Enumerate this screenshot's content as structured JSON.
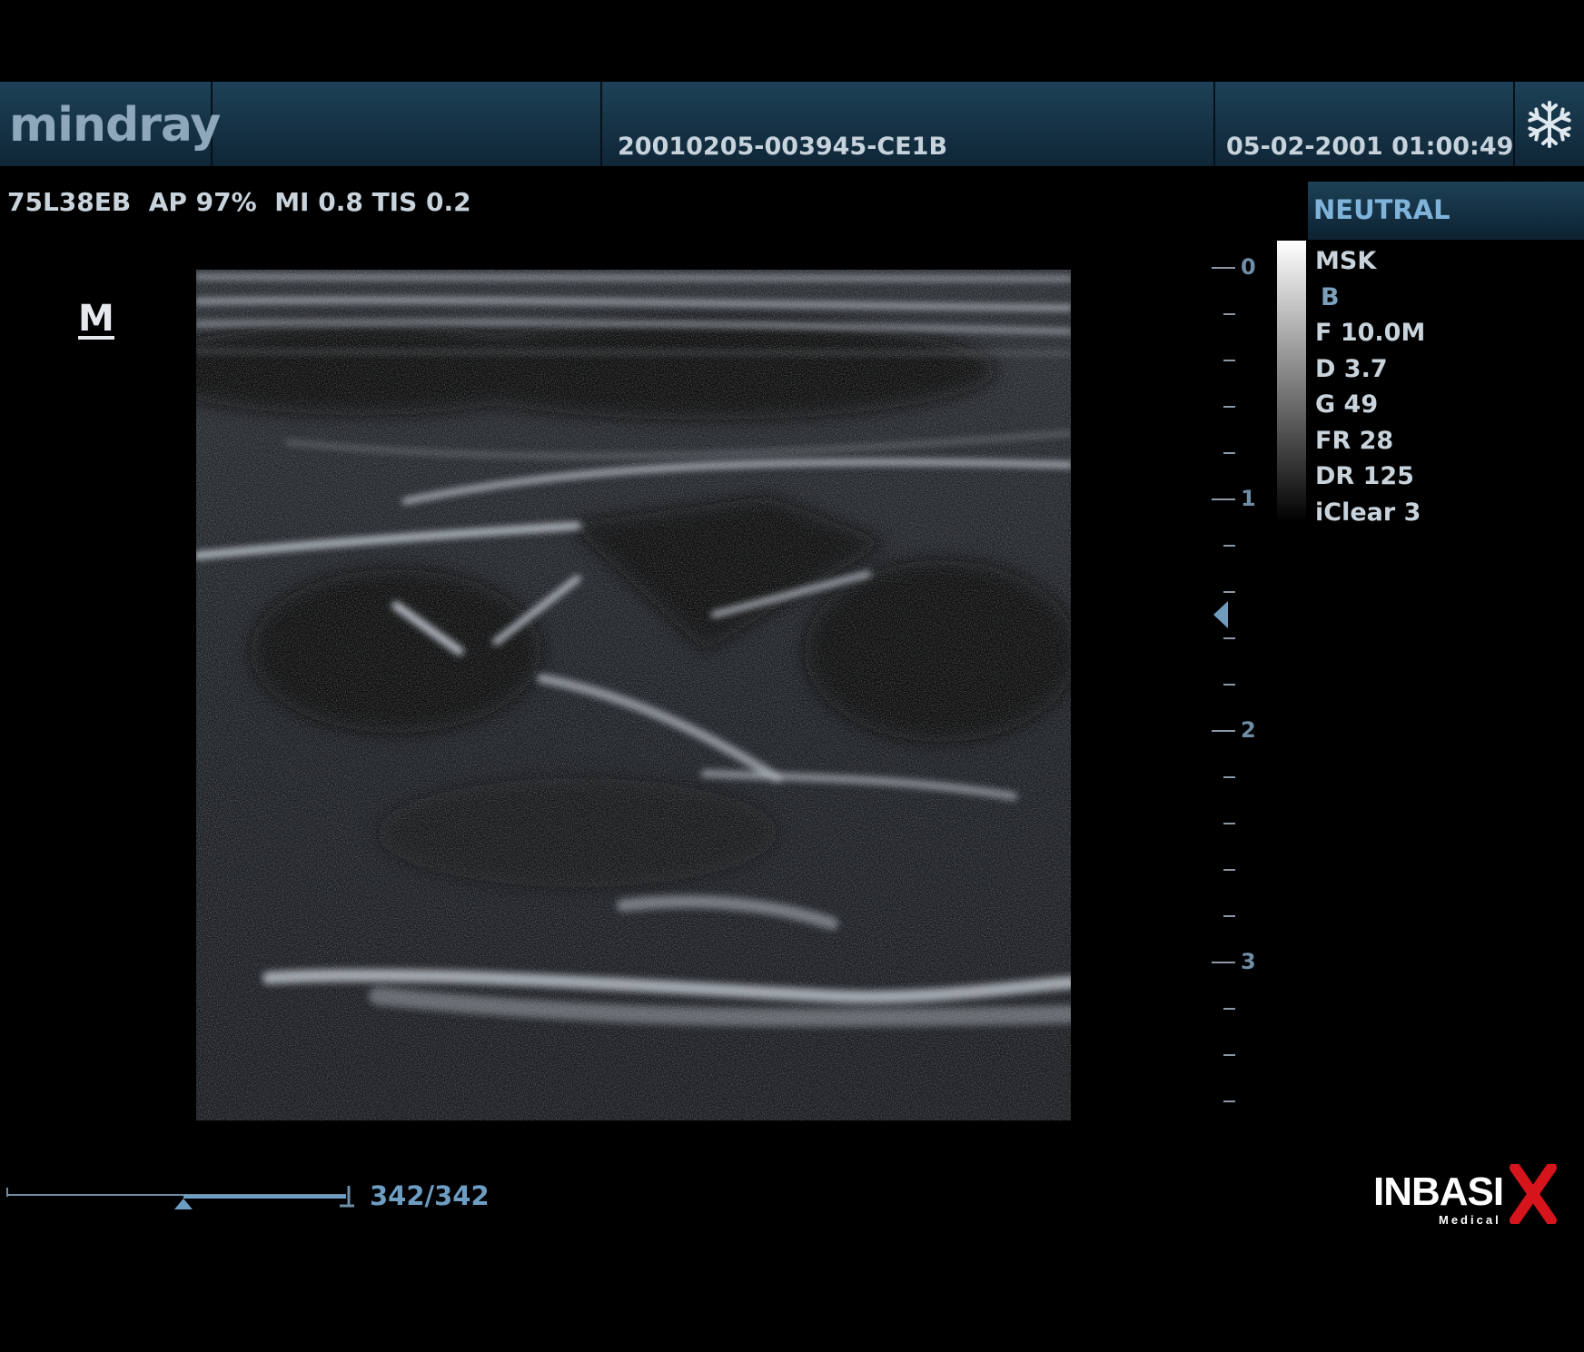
{
  "header": {
    "brand": "mindray",
    "patient_id": "20010205-003945-CE1B",
    "datetime": "05-02-2001 01:00:49",
    "freeze_icon": "snowflake-icon"
  },
  "probe_info": "75L38EB  AP 97%  MI 0.8 TIS 0.2",
  "orientation_marker": "M",
  "depth_scale": {
    "labels": [
      "0",
      "1",
      "2",
      "3"
    ],
    "unit_cm": true
  },
  "right_panel": {
    "preset": "NEUTRAL",
    "params": [
      "MSK",
      "B",
      "F 10.0M",
      "D 3.7",
      "G 49",
      "FR 28",
      "DR 125",
      "iClear 3"
    ]
  },
  "cine": {
    "counter": "342/342",
    "position_fraction": 0.52
  },
  "watermark": {
    "name": "INBASIX",
    "sub": "Medical"
  },
  "colors": {
    "header": "#1d4157",
    "accent": "#6d9dc2",
    "background": "#000000"
  }
}
